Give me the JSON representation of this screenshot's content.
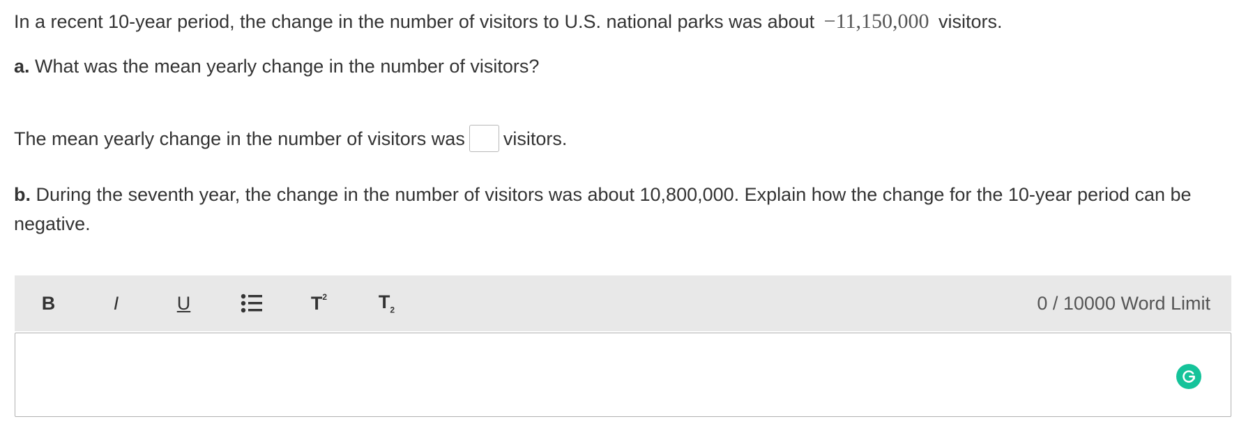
{
  "problem": {
    "intro_before": "In a recent 10-year period, the change in the number of visitors to U.S. national parks was about",
    "intro_math": "−11,150,000",
    "intro_after": "visitors.",
    "part_a": {
      "label": "a.",
      "question": "What was the mean yearly change in the number of visitors?",
      "answer_before": "The mean yearly change in the number of visitors was",
      "answer_value": "",
      "answer_after": "visitors."
    },
    "part_b": {
      "label": "b.",
      "question": "During the seventh year, the change in the number of visitors was about 10,800,000. Explain how the change for the 10-year period can be negative."
    }
  },
  "editor": {
    "toolbar": {
      "bold_label": "B",
      "italic_label": "I",
      "underline_label": "U",
      "list_icon": "bulleted-list-icon",
      "superscript_label": "T",
      "superscript_mark": "2",
      "subscript_label": "T",
      "subscript_mark": "2"
    },
    "word_count": "0 / 10000 Word Limit",
    "text_value": "",
    "grammarly_icon": "grammarly-icon",
    "grammarly_color": "#15c39a"
  }
}
